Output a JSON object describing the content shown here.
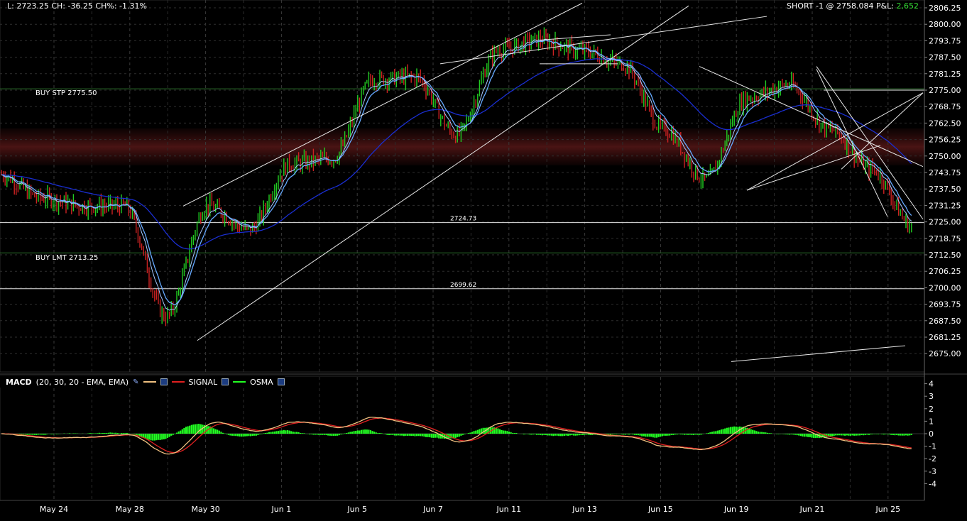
{
  "header": {
    "stats": "L: 2723.25 CH: -36.25 CH%: -1.31%",
    "position": "SHORT -1 @ 2758.084 P&L:",
    "pnl": "2,652"
  },
  "price_panel": {
    "y_ticks": [
      "2806.25",
      "2800.00",
      "2793.75",
      "2787.50",
      "2781.25",
      "2775.00",
      "2768.75",
      "2762.50",
      "2756.25",
      "2750.00",
      "2743.75",
      "2737.50",
      "2731.25",
      "2725.00",
      "2718.75",
      "2712.50",
      "2706.25",
      "2700.00",
      "2693.75",
      "2687.50",
      "2681.25",
      "2675.00"
    ],
    "order_lines": [
      {
        "label": "BUY STP 2775.50",
        "price": 2775.5
      },
      {
        "label": "BUY LMT 2713.25",
        "price": 2713.25
      }
    ],
    "level_lines": [
      {
        "label": "2724.73",
        "price": 2724.73
      },
      {
        "label": "2699.62",
        "price": 2699.62
      }
    ],
    "resistance_zone": [
      2746.5,
      2760.5
    ]
  },
  "macd_panel": {
    "title": "MACD",
    "params": "(20, 30, 20 - EMA, EMA)",
    "signal_label": "SIGNAL",
    "osma_label": "OSMA",
    "y_ticks": [
      "4",
      "3",
      "2",
      "1",
      "0",
      "-1",
      "-2",
      "-3",
      "-4"
    ]
  },
  "x_axis": {
    "labels": [
      "May 24",
      "May 28",
      "May 30",
      "Jun 1",
      "Jun 5",
      "Jun 7",
      "Jun 11",
      "Jun 13",
      "Jun 15",
      "Jun 19",
      "Jun 21",
      "Jun 25"
    ]
  },
  "colors": {
    "up_bar": "#22cc22",
    "down_bar": "#cc2222",
    "fast_ma": "#66aaff",
    "slow_ma": "#1a2ed0",
    "macd_line": "#f0c080",
    "signal_line": "#e02020",
    "osma": "#22ff22",
    "pnl": "#33dd33"
  },
  "chart_data": {
    "type": "line",
    "title": "",
    "x": [
      "May 24",
      "May 28",
      "May 30",
      "Jun 1",
      "Jun 5",
      "Jun 7",
      "Jun 11",
      "Jun 13",
      "Jun 15",
      "Jun 19",
      "Jun 21",
      "Jun 25"
    ],
    "series": [
      {
        "values": [
          2743,
          2734,
          2731,
          2731,
          2689,
          2731,
          2722,
          2747,
          2749,
          2779,
          2780,
          2758,
          2790,
          2794,
          2790,
          2785,
          2760,
          2741,
          2772,
          2777,
          2760,
          2745,
          2723
        ]
      }
    ],
    "ylabel": "",
    "ylim": [
      2671,
      2809
    ],
    "grid": true
  }
}
